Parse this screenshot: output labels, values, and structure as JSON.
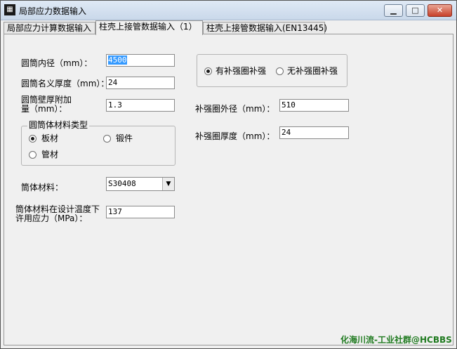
{
  "window": {
    "title": "局部应力数据输入",
    "icon": "app-icon",
    "controls": {
      "minimize": "▁",
      "maximize": "□",
      "close": "✕"
    }
  },
  "tabs": [
    {
      "label": "局部应力计算数据输入"
    },
    {
      "label": "柱壳上接管数据输入（1）"
    },
    {
      "label": "柱壳上接管数据输入(EN13445)"
    }
  ],
  "form": {
    "inner_diameter": {
      "label": "圆筒内径（mm）：",
      "value": "4500"
    },
    "nominal_thickness": {
      "label": "圆筒名义厚度（mm）：",
      "value": "24"
    },
    "wall_allowance": {
      "label_line1": "圆筒壁厚附加",
      "label_line2": "量（mm）：",
      "value": "1.3"
    },
    "material_type": {
      "title": "圆筒体材料类型",
      "options": [
        {
          "label": "板材",
          "selected": true
        },
        {
          "label": "锻件",
          "selected": false
        },
        {
          "label": "管材",
          "selected": false
        }
      ]
    },
    "shell_material": {
      "label": "筒体材料：",
      "value": "S30408",
      "dropdown_icon": "▼"
    },
    "allowable_stress": {
      "label_line1": "筒体材料在设计温度下",
      "label_line2": "许用应力（MPa）：",
      "value": "137"
    },
    "reinforcement": {
      "options": [
        {
          "label": "有补强圈补强",
          "selected": true
        },
        {
          "label": "无补强圈补强",
          "selected": false
        }
      ]
    },
    "ring_outer_diameter": {
      "label": "补强圈外径（mm）：",
      "value": "510"
    },
    "ring_thickness": {
      "label": "补强圈厚度（mm）：",
      "value": "24"
    }
  },
  "watermark": "化海川流-工业社群@HCBBS"
}
